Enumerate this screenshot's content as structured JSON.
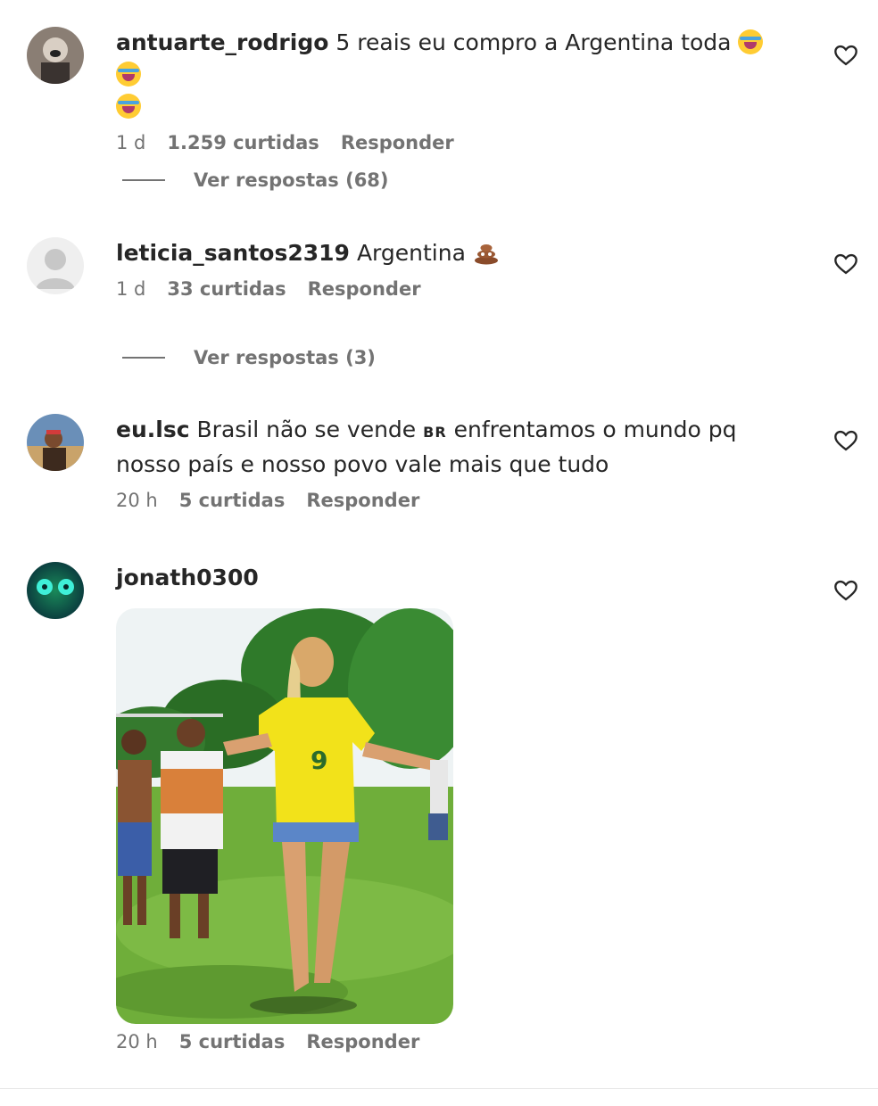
{
  "comments": [
    {
      "username": "antuarte_rodrigo",
      "text": "5 reais eu compro a Argentina toda",
      "emojis": [
        "face-with-tears-of-joy",
        "face-with-tears-of-joy",
        "face-with-tears-of-joy"
      ],
      "time": "1 d",
      "likes": "1.259 curtidas",
      "reply_label": "Responder",
      "view_replies": "Ver respostas (68)"
    },
    {
      "username": "leticia_santos2319",
      "text": "Argentina",
      "emojis": [
        "pile-of-poo"
      ],
      "time": "1 d",
      "likes": "33 curtidas",
      "reply_label": "Responder",
      "view_replies": "Ver respostas (3)"
    },
    {
      "username": "eu.lsc",
      "text_before": "Brasil não se vende",
      "flag_code": "BR",
      "text_after": "enfrentamos o mundo pq nosso país e nosso povo vale mais que tudo",
      "time": "20 h",
      "likes": "5 curtidas",
      "reply_label": "Responder"
    },
    {
      "username": "jonath0300",
      "attachment": "photo",
      "time": "20 h",
      "likes": "5 curtidas",
      "reply_label": "Responder"
    }
  ],
  "icons": {
    "like": "heart-outline-icon"
  },
  "colors": {
    "primary_text": "#262626",
    "secondary_text": "#737373",
    "jersey_yellow": "#f2e21a"
  }
}
